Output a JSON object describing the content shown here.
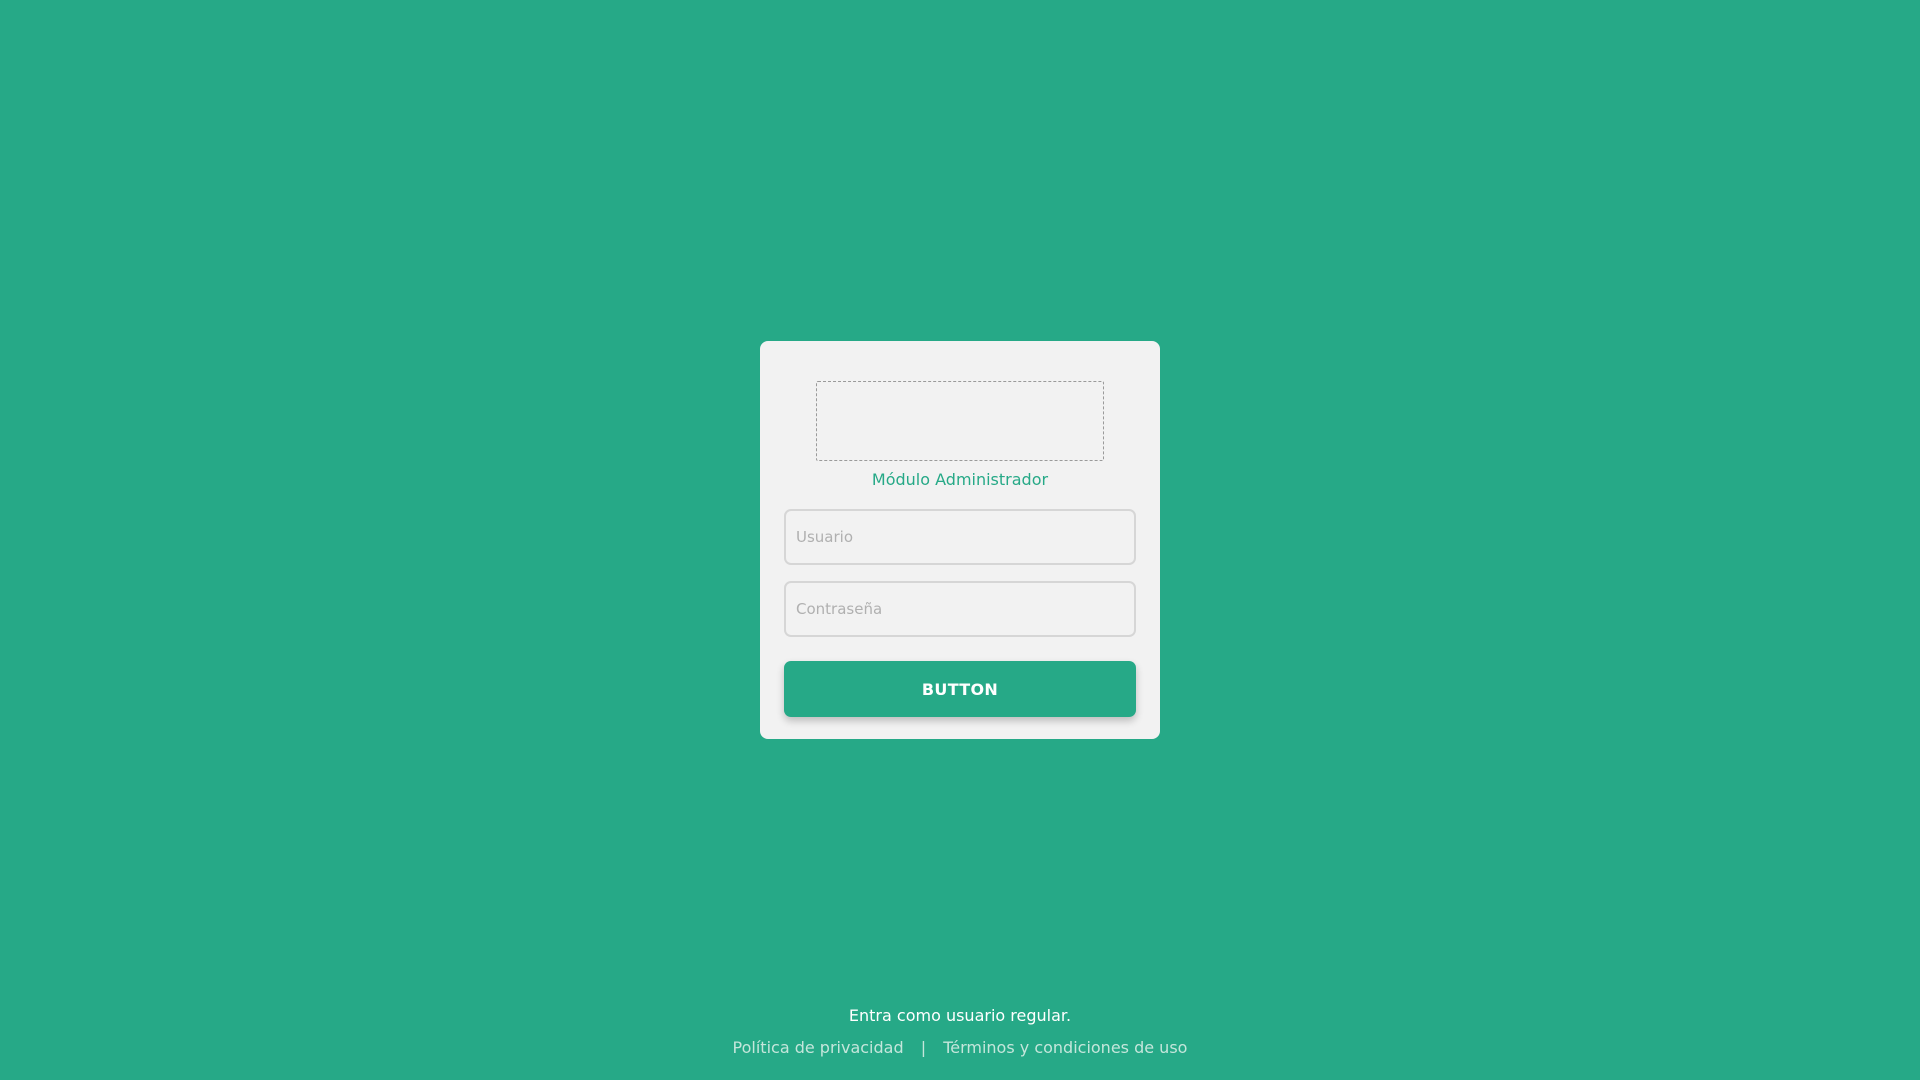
{
  "login": {
    "module_title": "Módulo Administrador",
    "username_placeholder": "Usuario",
    "password_placeholder": "Contraseña",
    "submit_label": "BUTTON"
  },
  "footer": {
    "regular_user_link": "Entra como usuario regular.",
    "privacy_link": "Política de privacidad",
    "separator": "|",
    "terms_link": "Términos y condiciones de uso"
  },
  "colors": {
    "background": "#26a987",
    "card": "#f2f2f2",
    "accent": "#26a987"
  }
}
